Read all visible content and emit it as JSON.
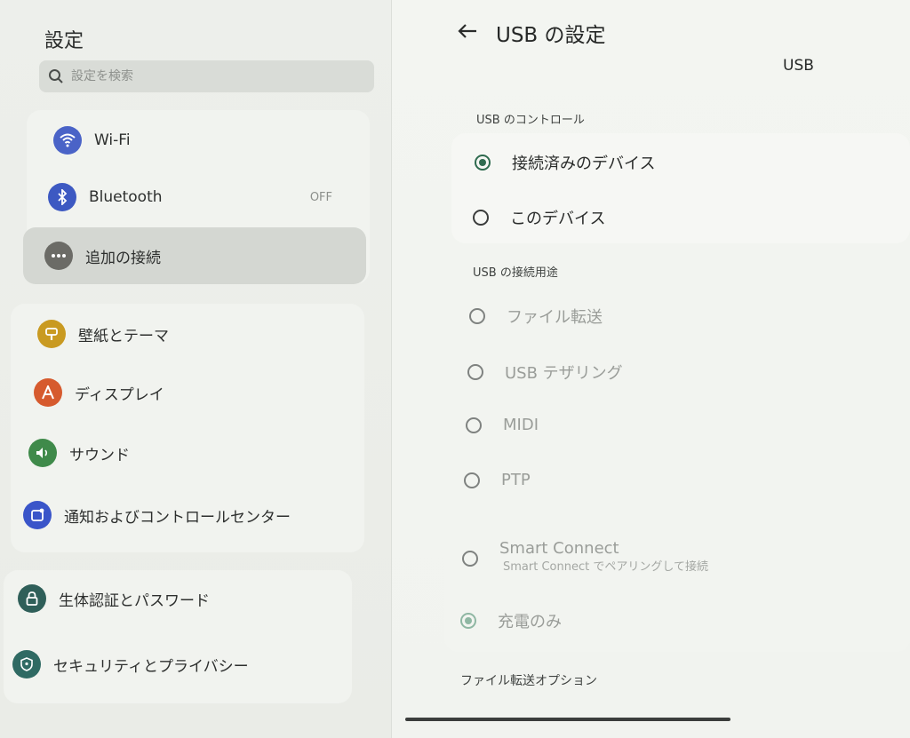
{
  "sidebar": {
    "title": "設定",
    "search_placeholder": "設定を検索",
    "items": [
      {
        "label": "Wi-Fi"
      },
      {
        "label": "Bluetooth",
        "status": "OFF"
      },
      {
        "label": "追加の接続"
      },
      {
        "label": "壁紙とテーマ"
      },
      {
        "label": "ディスプレイ"
      },
      {
        "label": "サウンド"
      },
      {
        "label": "通知およびコントロールセンター"
      },
      {
        "label": "生体認証とパスワード"
      },
      {
        "label": "セキュリティとプライバシー"
      }
    ]
  },
  "detail": {
    "title": "USB の設定",
    "header_label": "USB",
    "control_section": "USB のコントロール",
    "control_options": [
      {
        "label": "接続済みのデバイス",
        "checked": true
      },
      {
        "label": "このデバイス",
        "checked": false
      }
    ],
    "usage_section": "USB の接続用途",
    "usage_options": [
      {
        "label": "ファイル転送"
      },
      {
        "label": "USB テザリング"
      },
      {
        "label": "MIDI"
      },
      {
        "label": "PTP"
      },
      {
        "label": "Smart Connect",
        "subtitle": "Smart Connect でペアリングして接続"
      },
      {
        "label": "充電のみ",
        "checked": true
      }
    ],
    "file_transfer_options": "ファイル転送オプション"
  },
  "colors": {
    "wifi_icon": "#4a63c7",
    "bluetooth_icon": "#3d59c2",
    "more_icon": "#6b6b66",
    "wallpaper_icon": "#c99a21",
    "display_icon": "#d65a2e",
    "sound_icon": "#3f8a4a",
    "notification_icon": "#3a55c9",
    "biometric_icon": "#2f5f59",
    "security_icon": "#2f6a63",
    "accent": "#2f6b4f"
  }
}
